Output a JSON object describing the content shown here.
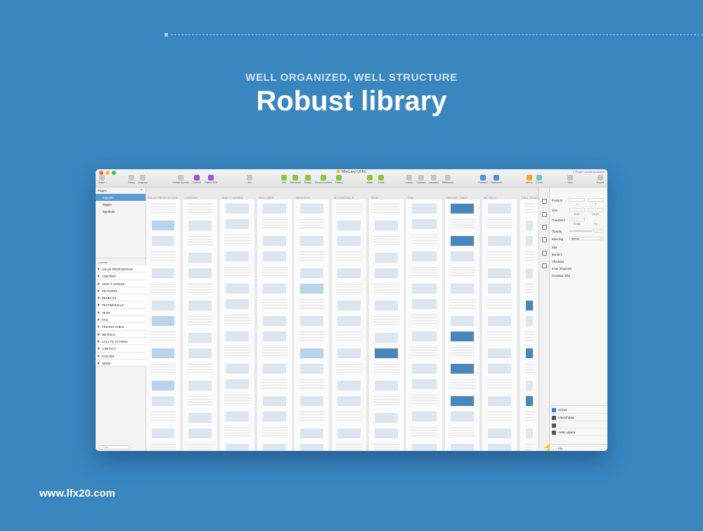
{
  "header": {
    "eyebrow": "WELL ORGANIZED, WELL STRUCTURE",
    "title": "Robust library"
  },
  "footer": {
    "website": "www.lfx20.com"
  },
  "window": {
    "title": "WireLand UI Kit",
    "notice": "1 Plugin Update Available"
  },
  "toolbar": {
    "insert": "Insert",
    "group": "Group",
    "ungroup": "Ungroup",
    "create_symbol": "Create Symbol",
    "symbol": "Symbol",
    "styled_text": "Styled Text",
    "zoom": "9%",
    "edit": "Edit",
    "transform": "Transform",
    "rotate": "Rotate",
    "round_corners": "Round Corners",
    "flatten": "Flatten",
    "mask": "Mask",
    "scale": "Scale",
    "union": "Union",
    "subtract": "Subtract",
    "intersect": "Intersect",
    "difference": "Difference",
    "forward": "Forward",
    "backward": "Backward",
    "mirror": "Mirror",
    "cloud": "Cloud",
    "view": "View",
    "export": "Export"
  },
  "sidebar": {
    "pages_heading": "Pages",
    "pages": [
      {
        "label": "Layouts",
        "selected": true
      },
      {
        "label": "Pages",
        "selected": false
      },
      {
        "label": "Symbols",
        "selected": false
      }
    ],
    "layers_heading": "Layouts",
    "layers": [
      "VALUE PROPOSITION",
      "CONTENT",
      "HOW IT WORKS",
      "FEATURES",
      "BENEFITS",
      "TESTIMONIALS",
      "TEAM",
      "FAQ",
      "PRICING TABLE",
      "METRICS",
      "CALL TO ACTIONS",
      "CONTACT",
      "FOOTER",
      "NEWS"
    ],
    "filter_placeholder": "Filter"
  },
  "canvas": {
    "artboards": [
      "VALUE PROPOSITION",
      "CONTENT",
      "HOW IT WORKS",
      "FEATURES",
      "BENEFITS",
      "TESTIMONIALS",
      "TEAM",
      "FAQ",
      "PRICING TABLE",
      "METRICS",
      "CALL TO ACTIONS"
    ]
  },
  "inspector": {
    "position": "Position",
    "size": "Size",
    "width": "Width",
    "height": "Height",
    "transform": "Transform",
    "rotate": "Rotate",
    "flip": "Flip",
    "opacity": "Opacity",
    "blending": "Blending",
    "blending_value": "Normal",
    "fills": "Fills",
    "borders": "Borders",
    "shadows": "Shadows",
    "inner_shadows": "Inner Shadows",
    "blur": "Gaussian Blur",
    "x": "X",
    "y": "Y"
  },
  "plugins": {
    "items": [
      "Anima",
      "Launchpad",
      "Auto Layout"
    ],
    "file_label": "File"
  }
}
